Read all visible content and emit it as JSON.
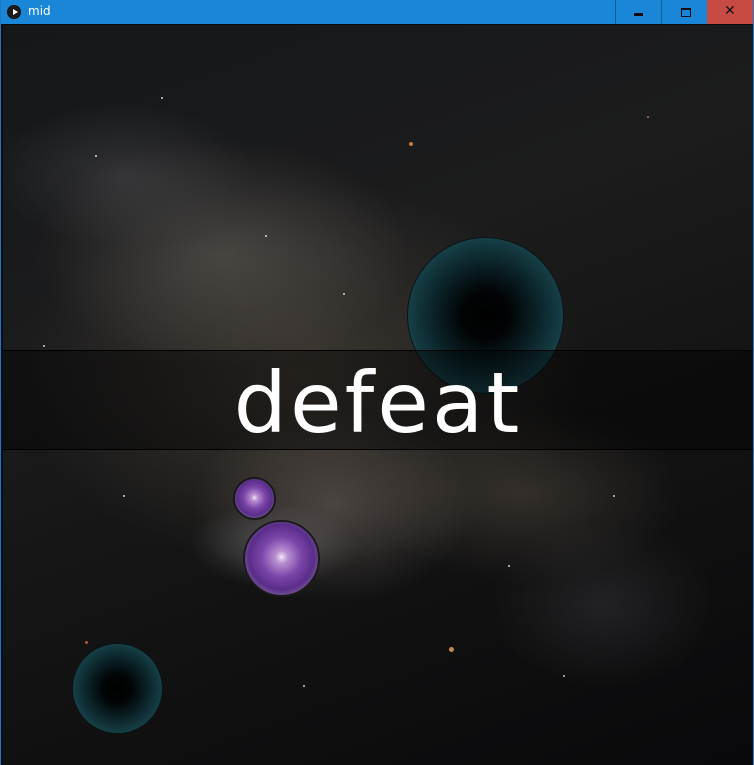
{
  "window": {
    "title": "mid",
    "app_icon": "play-icon",
    "controls": [
      "minimize-icon",
      "maximize-icon",
      "close-icon"
    ],
    "close_glyph": "✕",
    "accent_color": "#1a86d8",
    "close_color": "#c74b43"
  },
  "game": {
    "background": "spiral galaxy",
    "status_text": "defeat",
    "objects": [
      "black-hole",
      "purple-vortex",
      "purple-vortex",
      "black-hole"
    ]
  }
}
